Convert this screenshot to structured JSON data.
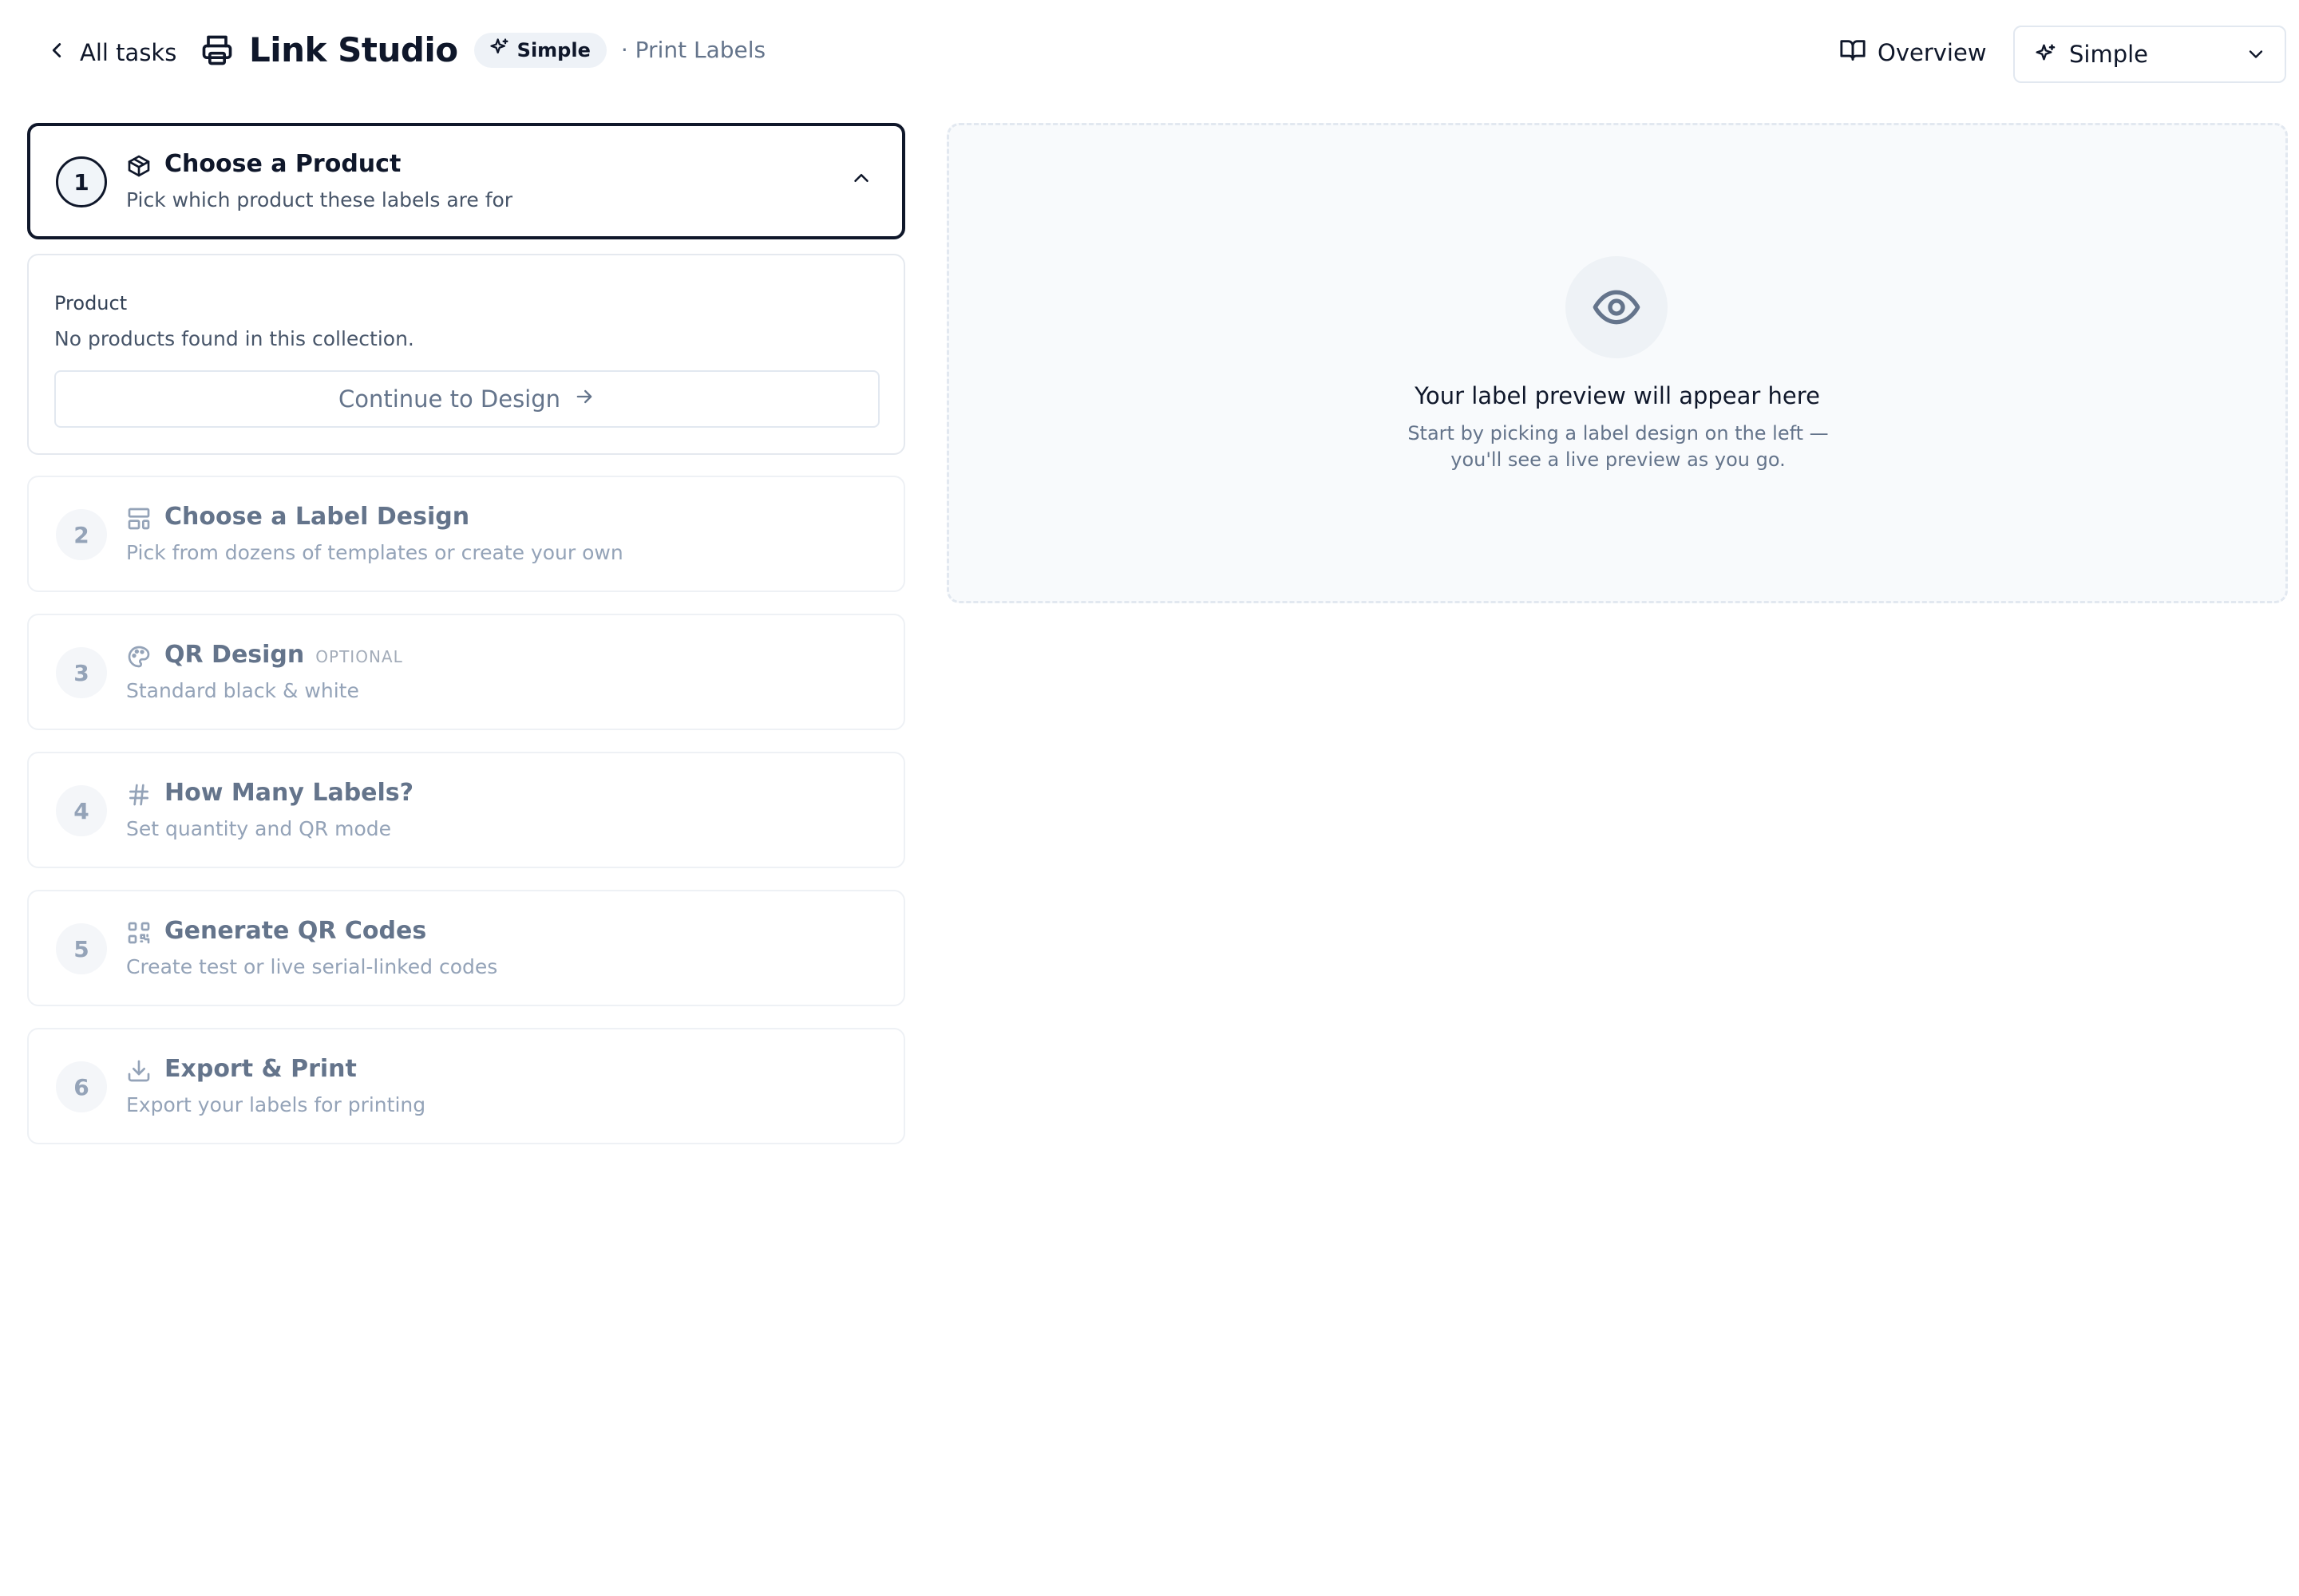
{
  "header": {
    "back_label": "All tasks",
    "app_title": "Link Studio",
    "mode_badge": "Simple",
    "breadcrumb": "· Print Labels",
    "overview_label": "Overview",
    "mode_select_value": "Simple"
  },
  "steps": [
    {
      "number": "1",
      "title": "Choose a Product",
      "description": "Pick which product these labels are for",
      "icon": "package-icon",
      "active": true
    },
    {
      "number": "2",
      "title": "Choose a Label Design",
      "description": "Pick from dozens of templates or create your own",
      "icon": "layout-template-icon"
    },
    {
      "number": "3",
      "title": "QR Design",
      "tag": "OPTIONAL",
      "description": "Standard black & white",
      "icon": "palette-icon"
    },
    {
      "number": "4",
      "title": "How Many Labels?",
      "description": "Set quantity and QR mode",
      "icon": "hash-icon"
    },
    {
      "number": "5",
      "title": "Generate QR Codes",
      "description": "Create test or live serial-linked codes",
      "icon": "qr-code-icon"
    },
    {
      "number": "6",
      "title": "Export & Print",
      "description": "Export your labels for printing",
      "icon": "download-icon"
    }
  ],
  "product_panel": {
    "label": "Product",
    "empty_message": "No products found in this collection.",
    "continue_label": "Continue to Design"
  },
  "preview": {
    "title": "Your label preview will appear here",
    "description": "Start by picking a label design on the left — you'll see a live preview as you go."
  },
  "colors": {
    "text_primary": "#0f172a",
    "text_muted": "#64748b",
    "border": "#e2e8f0",
    "preview_bg": "#f8fafc"
  }
}
